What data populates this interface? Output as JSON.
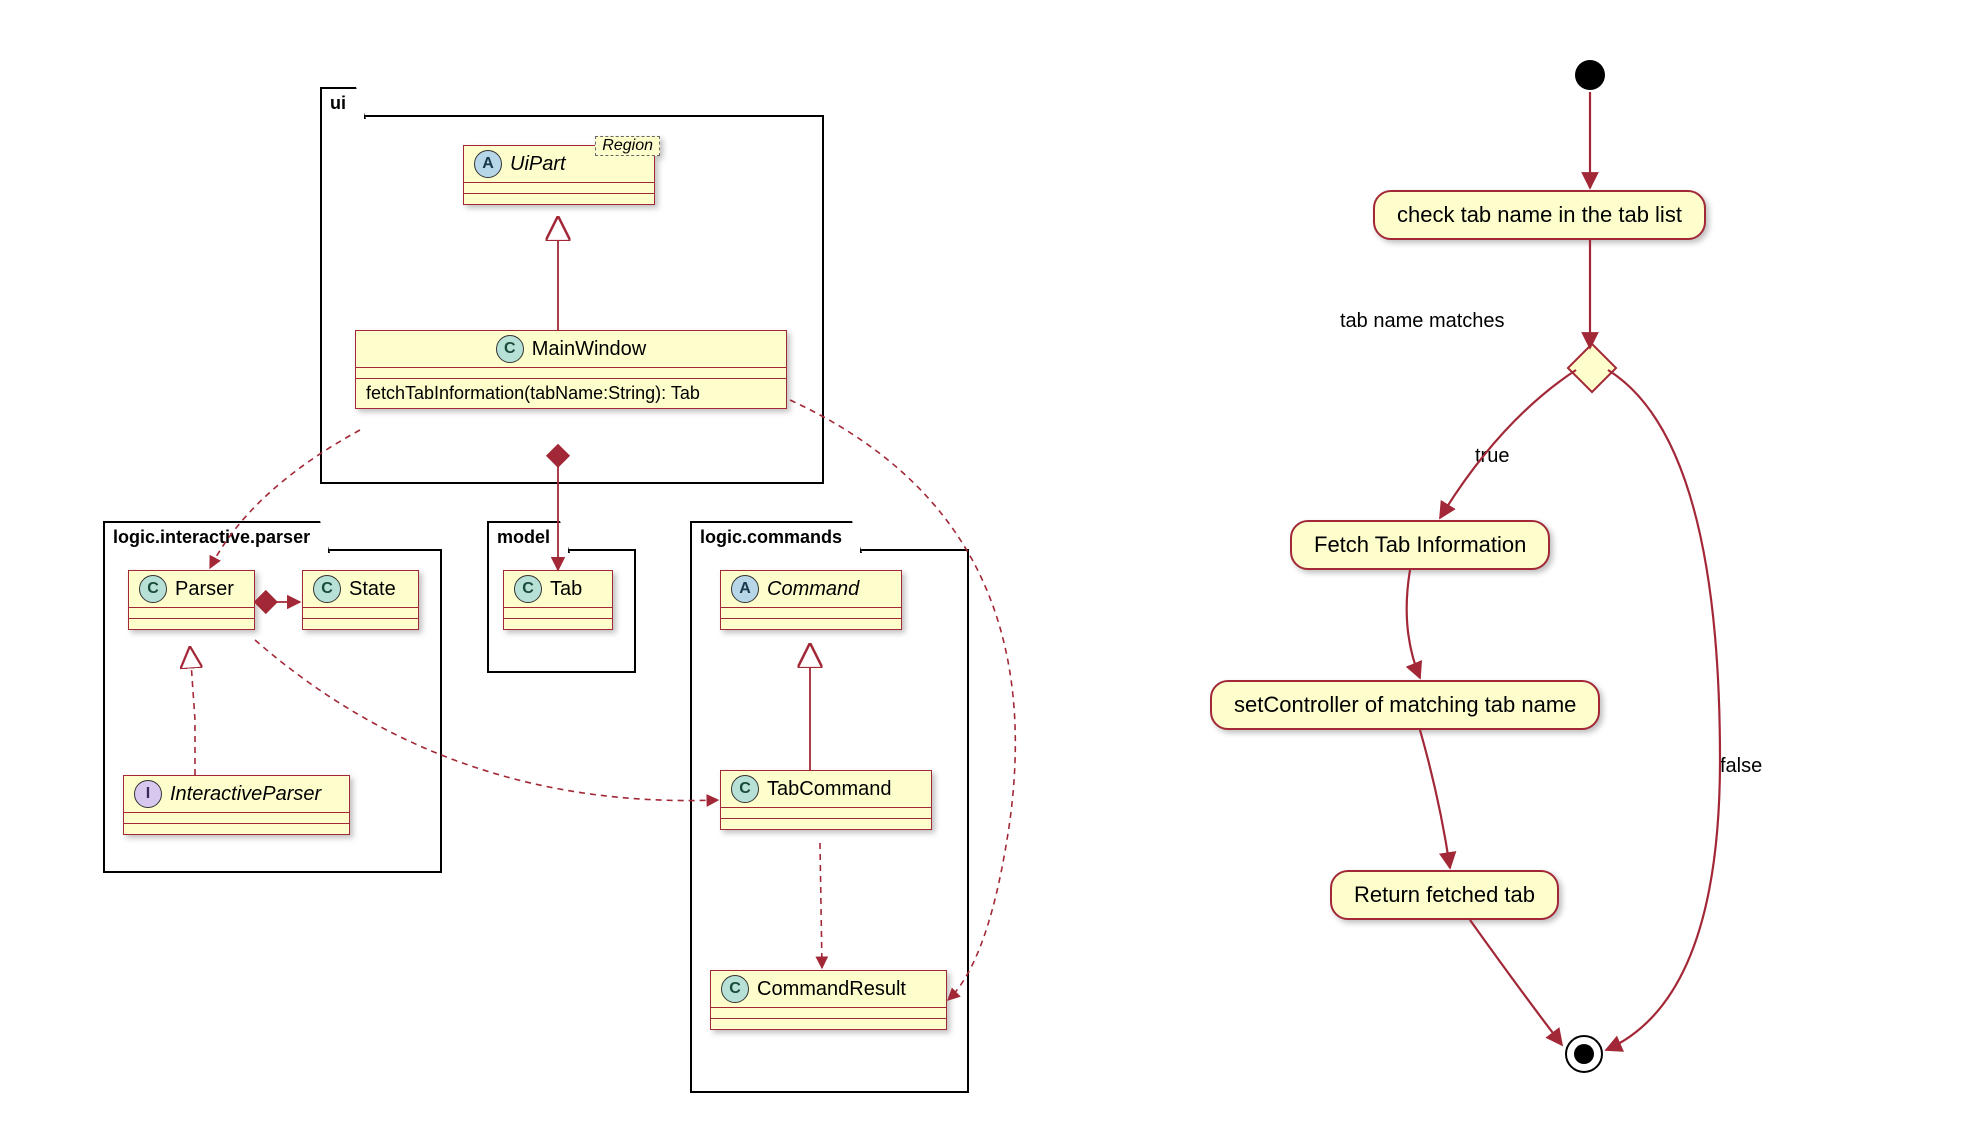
{
  "packages": {
    "ui": {
      "label": "ui"
    },
    "parser": {
      "label": "logic.interactive.parser"
    },
    "model": {
      "label": "model"
    },
    "commands": {
      "label": "logic.commands"
    }
  },
  "classes": {
    "uipart": {
      "stereo": "A",
      "name": "UiPart",
      "region": "Region"
    },
    "mainwindow": {
      "stereo": "C",
      "name": "MainWindow",
      "method": "fetchTabInformation(tabName:String): Tab"
    },
    "parser": {
      "stereo": "C",
      "name": "Parser"
    },
    "state": {
      "stereo": "C",
      "name": "State"
    },
    "iparser": {
      "stereo": "I",
      "name": "InteractiveParser"
    },
    "tab": {
      "stereo": "C",
      "name": "Tab"
    },
    "command": {
      "stereo": "A",
      "name": "Command"
    },
    "tabcommand": {
      "stereo": "C",
      "name": "TabCommand"
    },
    "cmdresult": {
      "stereo": "C",
      "name": "CommandResult"
    }
  },
  "activity": {
    "check": "check tab name in the tab list",
    "guard": "tab name matches",
    "true": "true",
    "false": "false",
    "fetch": "Fetch Tab Information",
    "setctrl": "setController of matching tab name",
    "ret": "Return fetched tab"
  }
}
